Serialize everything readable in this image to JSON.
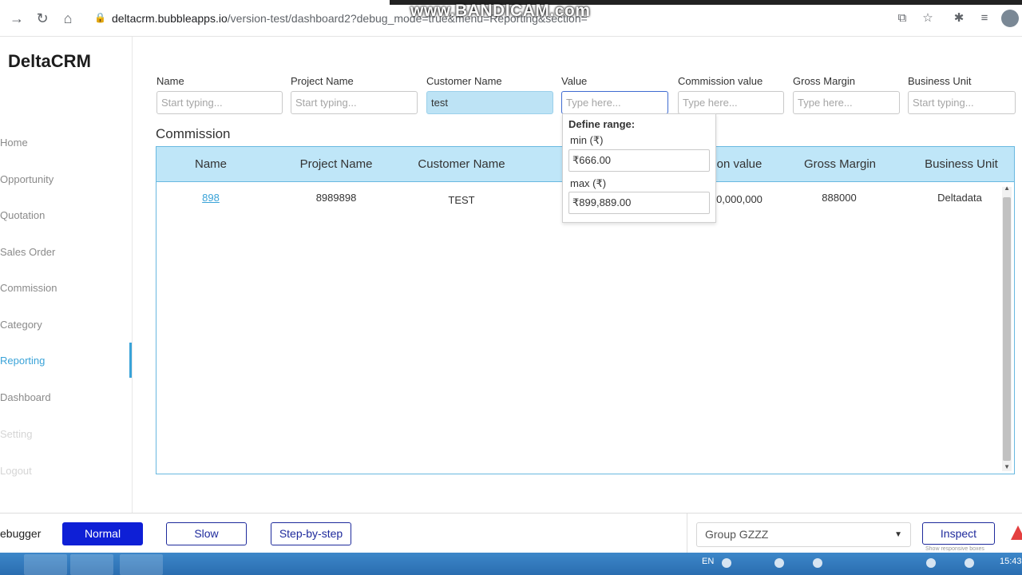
{
  "browser": {
    "url_host": "deltacrm.bubbleapps.io",
    "url_path": "/version-test/dashboard2?debug_mode=true&menu=Reporting&section=",
    "watermark": "www.BANDICAM.com"
  },
  "sidebar": {
    "brand": "DeltaCRM",
    "items": [
      {
        "label": "Home"
      },
      {
        "label": "Opportunity"
      },
      {
        "label": "Quotation"
      },
      {
        "label": "Sales Order"
      },
      {
        "label": "Commission"
      },
      {
        "label": "Category"
      },
      {
        "label": "Reporting"
      },
      {
        "label": "Dashboard"
      },
      {
        "label": "Setting"
      },
      {
        "label": "Logout"
      }
    ]
  },
  "filters": [
    {
      "label": "Name",
      "value": "",
      "placeholder": "Start typing..."
    },
    {
      "label": "Project Name",
      "value": "",
      "placeholder": "Start typing..."
    },
    {
      "label": "Customer Name",
      "value": "test",
      "placeholder": "Start typing..."
    },
    {
      "label": "Value",
      "value": "",
      "placeholder": "Type here..."
    },
    {
      "label": "Commission value",
      "value": "",
      "placeholder": "Type here..."
    },
    {
      "label": "Gross Margin",
      "value": "",
      "placeholder": "Type here..."
    },
    {
      "label": "Business Unit",
      "value": "",
      "placeholder": "Start typing..."
    }
  ],
  "range_popup": {
    "title": "Define range:",
    "min_label": "min (₹)",
    "min_value": "₹666.00",
    "max_label": "max (₹)",
    "max_value": "₹899,889.00"
  },
  "table": {
    "title": "Commission",
    "columns": [
      "Name",
      "Project Name",
      "Customer Name",
      "",
      "on value",
      "Gross Margin",
      "Business Unit"
    ],
    "rows": [
      [
        "898",
        "8989898",
        "TEST",
        "",
        "0,000,000",
        "888000",
        "Deltadata"
      ]
    ]
  },
  "debugger": {
    "label": "ebugger",
    "normal": "Normal",
    "slow": "Slow",
    "step": "Step-by-step",
    "group": "Group GZZZ",
    "inspect": "Inspect",
    "inspect_sub": "Show responsive boxes"
  },
  "taskbar": {
    "lang": "EN",
    "time": "15:43"
  }
}
